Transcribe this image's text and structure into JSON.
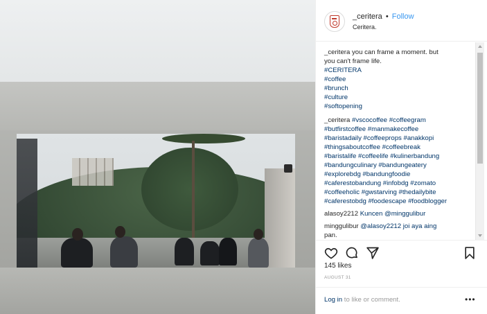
{
  "header": {
    "username": "_ceritera",
    "separator": "•",
    "follow_label": "Follow",
    "subtitle": "Ceritera."
  },
  "caption": {
    "lines": [
      "_ceritera you can frame a moment. but",
      "you can't frame life."
    ],
    "hashtags": [
      "#CERITERA",
      "#coffee",
      "#brunch",
      "#culture",
      "#softopening"
    ]
  },
  "comments": [
    {
      "lines": [
        {
          "user": "_ceritera",
          "text": "#vscocoffee #coffeegram"
        },
        {
          "text": "#butfirstcoffee #manmakecoffee"
        },
        {
          "text": "#baristadaily #coffeeprops #anakkopi"
        },
        {
          "text": "#thingsaboutcoffee #coffeebreak"
        },
        {
          "text": "#baristalife #coffeelife #kulinerbandung"
        },
        {
          "text": "#bandungculinary #bandungeatery"
        },
        {
          "text": "#explorebdg #bandungfoodie"
        },
        {
          "text": "#caferestobandung #infobdg #zomato"
        },
        {
          "text": "#coffeeholic #gwstarving #thedailybite"
        },
        {
          "text": "#caferestobdg #foodescape #foodblogger"
        }
      ]
    },
    {
      "user": "alasoy2212",
      "text": "Kuncen @minggulibur"
    },
    {
      "user": "minggulibur",
      "text": "@alasoy2212 joi aya aing",
      "text2": "pan."
    }
  ],
  "actions": {
    "like_icon": "heart-icon",
    "comment_icon": "comment-bubble-icon",
    "share_icon": "share-arrow-icon",
    "save_icon": "bookmark-icon"
  },
  "likes": "145 likes",
  "date": "AUGUST 31",
  "footer": {
    "login_label": "Log in",
    "login_rest": " to like or comment.",
    "more_label": "•••"
  },
  "colors": {
    "link": "#003569",
    "follow": "#3897f0",
    "muted": "#999999"
  }
}
